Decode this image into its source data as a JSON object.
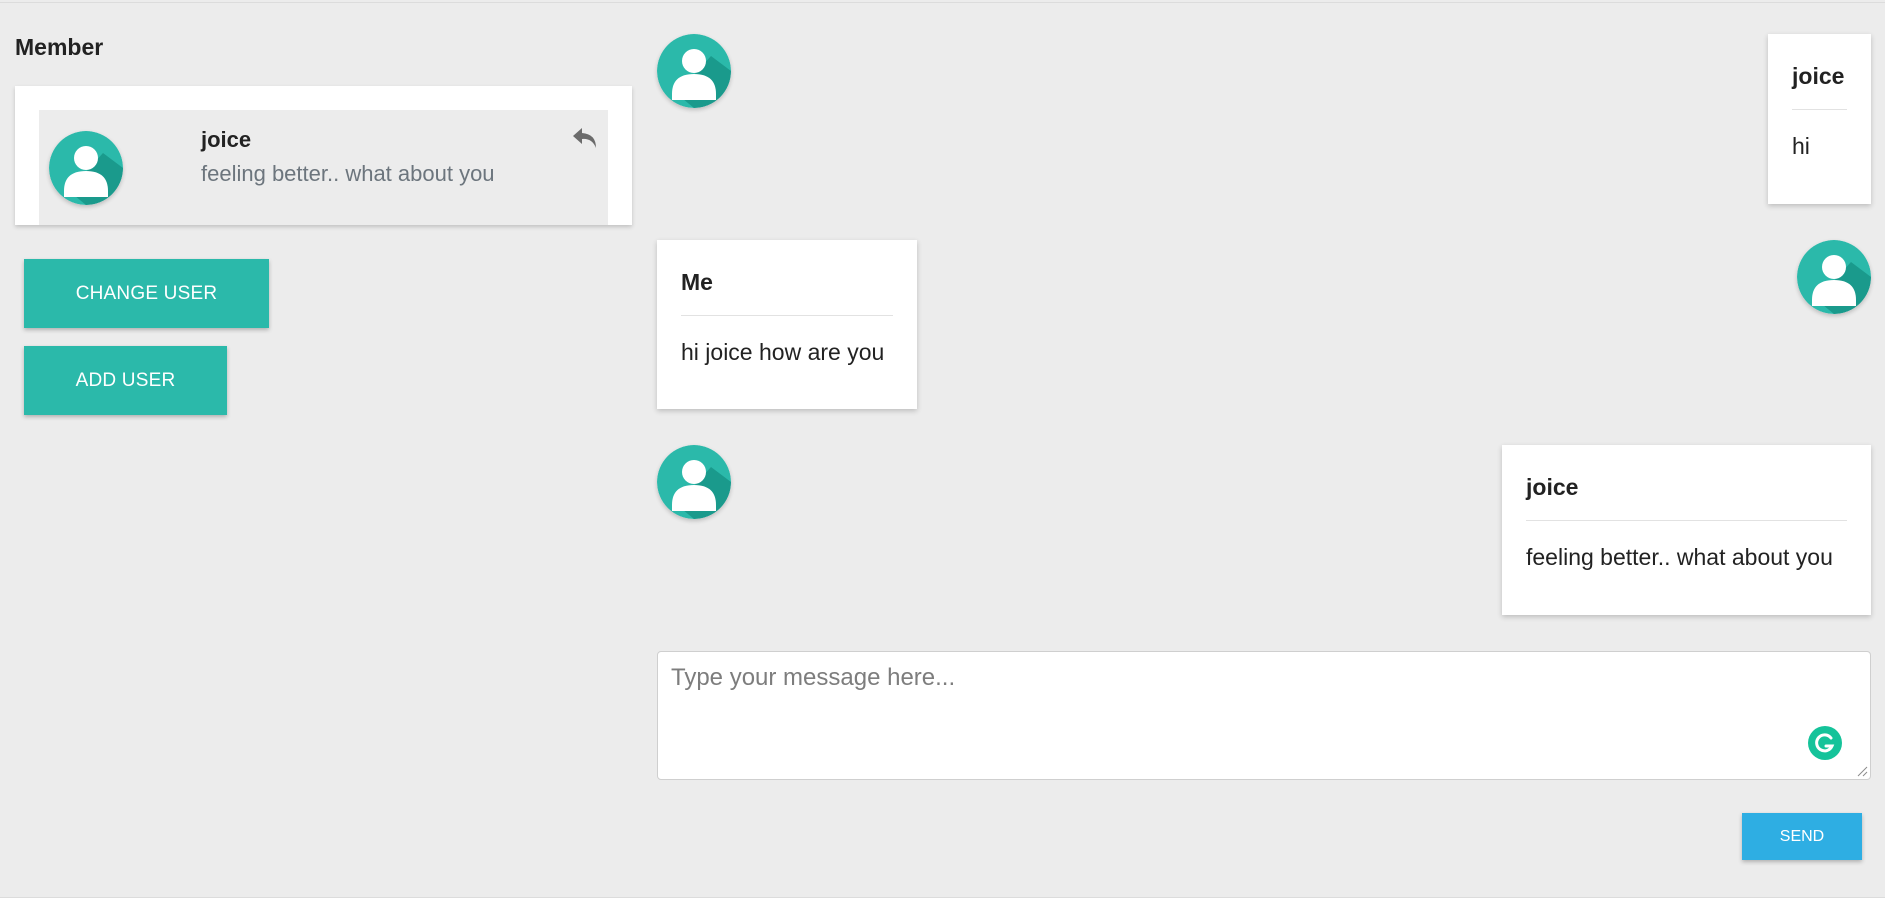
{
  "sidebar": {
    "title": "Member",
    "members": [
      {
        "name": "joice",
        "last_message": "feeling better.. what about you",
        "avatar_icon": "user-avatar-icon",
        "action_icon": "reply-icon"
      }
    ],
    "buttons": {
      "change_user": "CHANGE USER",
      "add_user": "ADD USER"
    }
  },
  "chat": {
    "messages": [
      {
        "sender": "joice",
        "text": "hi",
        "align": "right"
      },
      {
        "sender": "Me",
        "text": "hi joice how are you",
        "align": "left"
      },
      {
        "sender": "joice",
        "text": "feeling better.. what about you",
        "align": "right"
      }
    ],
    "composer": {
      "placeholder": "Type your message here...",
      "value": "",
      "send_label": "SEND",
      "assist_icon": "grammarly-icon"
    }
  },
  "colors": {
    "background": "#ececec",
    "teal": "#2bb9aa",
    "avatar_dark": "#16887b",
    "send_blue": "#2eaee3"
  }
}
